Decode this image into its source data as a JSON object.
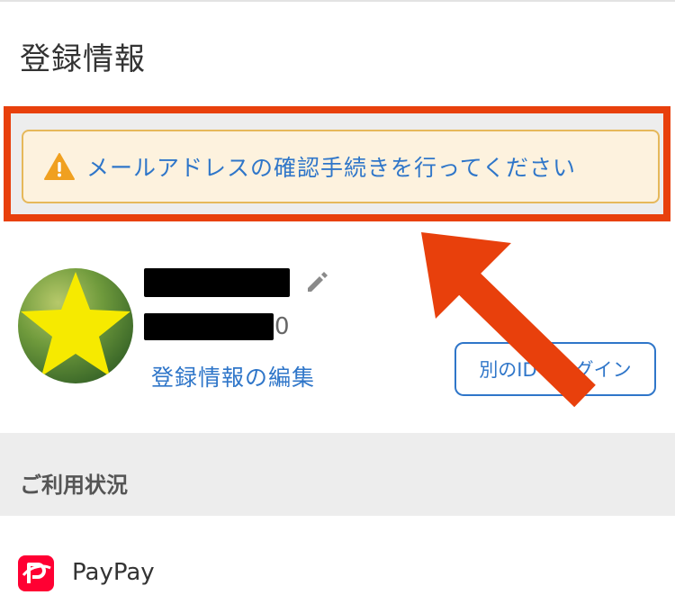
{
  "section": {
    "title": "登録情報"
  },
  "notice": {
    "text": "メールアドレスの確認手続きを行ってください"
  },
  "profile": {
    "id_suffix": "0",
    "edit_link": "登録情報の編集",
    "switch_button": "別のIDでログイン"
  },
  "usage": {
    "title": "ご利用状況"
  },
  "services": [
    {
      "name": "PayPay",
      "icon": "paypay-icon"
    }
  ],
  "colors": {
    "accent": "#2f76c9",
    "highlight": "#e8400c",
    "notice_bg": "#fdf2de",
    "warning": "#f0a020"
  }
}
